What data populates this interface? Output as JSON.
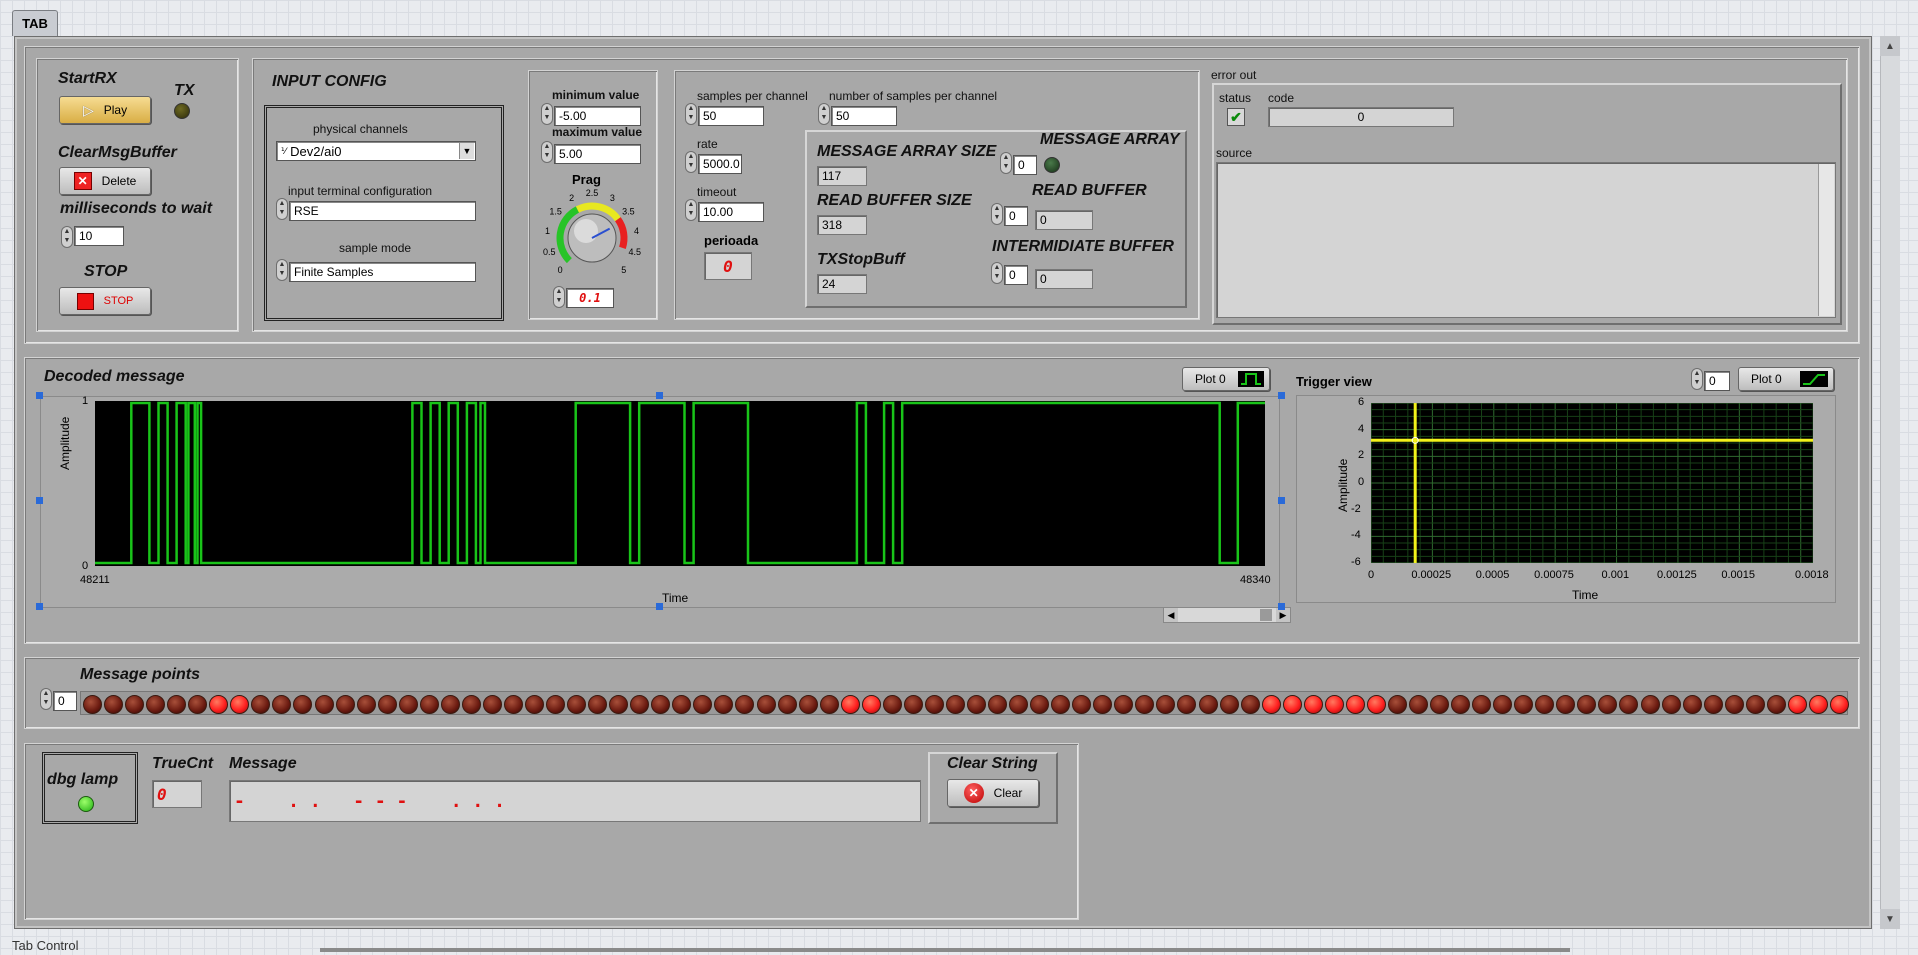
{
  "tab": {
    "label": "TAB",
    "footer_label": "Tab Control"
  },
  "control": {
    "startrx_label": "StartRX",
    "play_label": "Play",
    "tx_label": "TX",
    "clearmsg_label": "ClearMsgBuffer",
    "delete_label": "Delete",
    "wait_label": "milliseconds to wait",
    "wait_value": "10",
    "stop_label": "STOP",
    "stop_btn_label": "STOP"
  },
  "input_config": {
    "title": "INPUT CONFIG",
    "physical_channels_label": "physical channels",
    "physical_channels_value": "Dev2/ai0",
    "terminal_label": "input terminal configuration",
    "terminal_value": "RSE",
    "sample_mode_label": "sample mode",
    "sample_mode_value": "Finite Samples"
  },
  "range": {
    "min_label": "minimum value",
    "min_value": "-5.00",
    "max_label": "maximum value",
    "max_value": "5.00",
    "knob_label": "Prag",
    "knob_value": "0.1",
    "knob_ticks": [
      "0",
      "0.5",
      "1",
      "1.5",
      "2",
      "2.5",
      "3",
      "3.5",
      "4",
      "4.5",
      "5"
    ],
    "knob_position": 0.73
  },
  "timing": {
    "spc_label": "samples per channel",
    "spc_value": "50",
    "nspc_label": "number of samples per channel",
    "nspc_value": "50",
    "rate_label": "rate",
    "rate_value": "5000.0",
    "timeout_label": "timeout",
    "timeout_value": "10.00",
    "perioada_label": "perioada",
    "perioada_value": "0",
    "msg_array_size_label": "MESSAGE ARRAY SIZE",
    "msg_array_size_value": "117",
    "read_buf_size_label": "READ BUFFER SIZE",
    "read_buf_size_value": "318",
    "txstop_label": "TXStopBuff",
    "txstop_value": "24",
    "msg_array_label": "MESSAGE ARRAY",
    "msg_array_index": "0",
    "read_buffer_label": "READ BUFFER",
    "read_buffer_index": "0",
    "read_buffer_value": "0",
    "inter_buffer_label": "INTERMIDIATE BUFFER",
    "inter_buffer_index": "0",
    "inter_buffer_value": "0"
  },
  "error_out": {
    "title": "error out",
    "status_label": "status",
    "code_label": "code",
    "code_value": "0",
    "source_label": "source",
    "status_mark": "✔"
  },
  "decoded": {
    "title": "Decoded message",
    "plot_label": "Plot 0",
    "y_label": "Amplitude",
    "x_label": "Time",
    "y_ticks": [
      "1",
      "0"
    ],
    "x_min_label": "48211",
    "x_max_label": "48340"
  },
  "trigger": {
    "title": "Trigger view",
    "plot_index": "0",
    "plot_label": "Plot 0",
    "y_label": "Amplitude",
    "x_label": "Time",
    "y_ticks": [
      "6",
      "4",
      "2",
      "0",
      "-2",
      "-4",
      "-6"
    ],
    "x_ticks": [
      "0",
      "0.00025",
      "0.0005",
      "0.00075",
      "0.001",
      "0.00125",
      "0.0015",
      "0.0018"
    ]
  },
  "message_points": {
    "title": "Message points",
    "index": "0",
    "lamps": [
      0,
      0,
      0,
      0,
      0,
      0,
      1,
      1,
      0,
      0,
      0,
      0,
      0,
      0,
      0,
      0,
      0,
      0,
      0,
      0,
      0,
      0,
      0,
      0,
      0,
      0,
      0,
      0,
      0,
      0,
      0,
      0,
      0,
      0,
      0,
      0,
      1,
      1,
      0,
      0,
      0,
      0,
      0,
      0,
      0,
      0,
      0,
      0,
      0,
      0,
      0,
      0,
      0,
      0,
      0,
      0,
      1,
      1,
      1,
      1,
      1,
      1,
      0,
      0,
      0,
      0,
      0,
      0,
      0,
      0,
      0,
      0,
      0,
      0,
      0,
      0,
      0,
      0,
      0,
      0,
      0,
      1,
      1,
      1
    ]
  },
  "debug": {
    "lamp_label": "dbg lamp",
    "truecnt_label": "TrueCnt",
    "truecnt_value": "0",
    "message_label": "Message",
    "message_value": "-    . .   - - -    . . .",
    "clear_title": "Clear String",
    "clear_btn_label": "Clear"
  },
  "colors": {
    "signal_green": "#19c419",
    "cursor_yellow": "#f2f21a",
    "led_on": "#ff2020",
    "led_off": "#6a1a10"
  },
  "chart_data": [
    {
      "type": "line",
      "title": "Decoded message",
      "xlabel": "Time",
      "ylabel": "Amplitude",
      "xlim": [
        48211,
        48340
      ],
      "ylim": [
        0,
        1
      ],
      "series": [
        {
          "name": "Plot 0",
          "x": [
            48211,
            48215,
            48215,
            48217,
            48217,
            48218,
            48218,
            48219,
            48219,
            48220,
            48220,
            48221,
            48221,
            48221.3,
            48221.3,
            48222,
            48222,
            48222.3,
            48222.3,
            48222.7,
            48222.7,
            48246,
            48246,
            48247,
            48247,
            48248,
            48248,
            48249,
            48249,
            48250,
            48250,
            48251,
            48251,
            48252,
            48252,
            48253,
            48253,
            48253.5,
            48253.5,
            48254,
            48254,
            48264,
            48264,
            48270,
            48270,
            48271,
            48271,
            48276,
            48276,
            48277,
            48277,
            48283,
            48283,
            48295,
            48295,
            48296,
            48296,
            48298,
            48298,
            48299,
            48299,
            48300,
            48300,
            48335,
            48335,
            48337,
            48337,
            48340
          ],
          "y": [
            0,
            0,
            1,
            1,
            0,
            0,
            1,
            1,
            0,
            0,
            1,
            1,
            0,
            0,
            1,
            1,
            0,
            0,
            1,
            1,
            0,
            0,
            1,
            1,
            0,
            0,
            1,
            1,
            0,
            0,
            1,
            1,
            0,
            0,
            1,
            1,
            0,
            0,
            1,
            1,
            0,
            0,
            1,
            1,
            0,
            0,
            1,
            1,
            0,
            0,
            1,
            1,
            0,
            0,
            1,
            1,
            0,
            0,
            1,
            1,
            0,
            0,
            1,
            1,
            0,
            0,
            1,
            1
          ]
        }
      ]
    },
    {
      "type": "line",
      "title": "Trigger view",
      "xlabel": "Time",
      "ylabel": "Amplitude",
      "xlim": [
        0,
        0.0018
      ],
      "ylim": [
        -6,
        6
      ],
      "grid": true,
      "cursor": {
        "x": 0.00018,
        "y": 3.2
      },
      "series": [
        {
          "name": "Plot 0",
          "x": [
            0,
            0.0018
          ],
          "y": [
            3.2,
            3.2
          ]
        }
      ]
    }
  ]
}
